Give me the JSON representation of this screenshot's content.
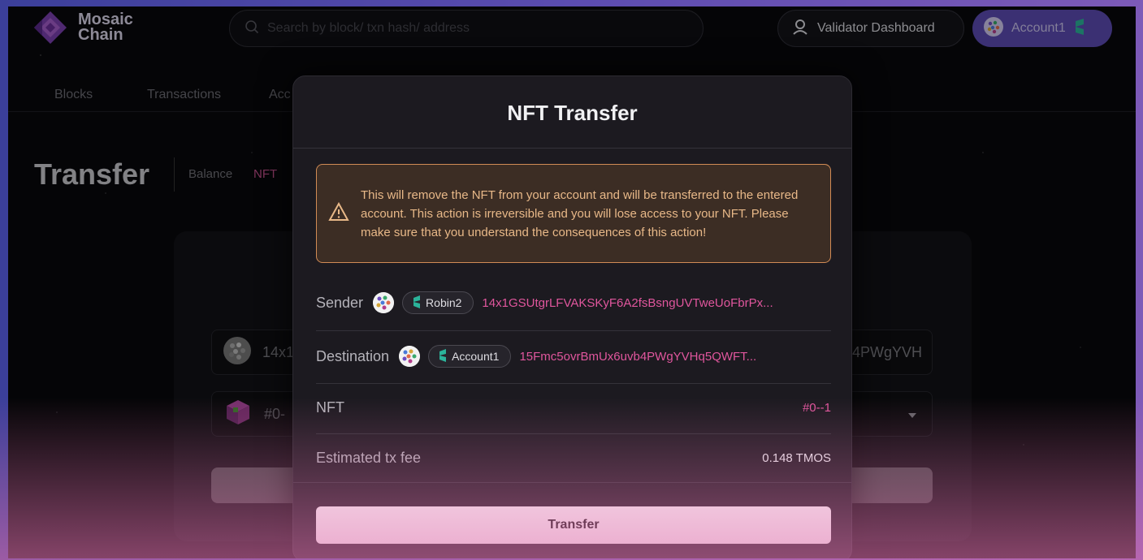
{
  "brand": {
    "name_line1": "Mosaic",
    "name_line2": "Chain"
  },
  "search": {
    "placeholder": "Search by block/ txn hash/ address"
  },
  "header": {
    "validator_label": "Validator Dashboard",
    "account_label": "Account1"
  },
  "nav": {
    "items": [
      "Blocks",
      "Transactions",
      "Acc"
    ]
  },
  "page": {
    "title": "Transfer",
    "crumb_balance": "Balance",
    "crumb_nft": "NFT"
  },
  "background_form": {
    "sender_partial": "14x1",
    "sender_tail": "4PWgYVH",
    "nft_partial": "#0-"
  },
  "modal": {
    "title": "NFT Transfer",
    "warning": "This will remove the NFT from your account and will be transferred to the entered account. This action is irreversible and you will lose access to your NFT. Please make sure that you understand the consequences of this action!",
    "sender_label": "Sender",
    "sender_name": "Robin2",
    "sender_address": "14x1GSUtgrLFVAKSKyF6A2fsBsngUVTweUoFbrPx...",
    "destination_label": "Destination",
    "destination_name": "Account1",
    "destination_address": "15Fmc5ovrBmUx6uvb4PWgYVHq5QWFT...",
    "nft_label": "NFT",
    "nft_value": "#0--1",
    "fee_label": "Estimated tx fee",
    "fee_value": "0.148 TMOS",
    "transfer_button": "Transfer"
  },
  "colors": {
    "accent_pink": "#e0569d",
    "warning_border": "#d18b55",
    "account_purple": "#5b4bb1"
  }
}
